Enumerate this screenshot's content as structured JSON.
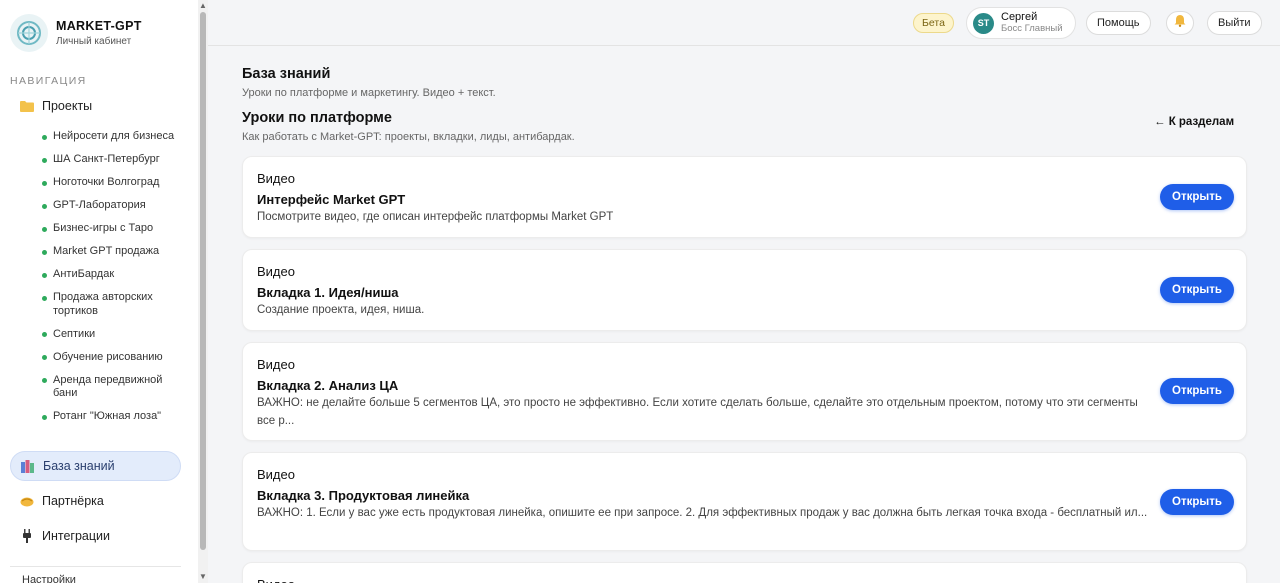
{
  "brand": {
    "name": "MARKET-GPT",
    "subtitle": "Личный кабинет"
  },
  "nav": {
    "heading": "НАВИГАЦИЯ",
    "projects_label": "Проекты",
    "projects": [
      "Нейросети для бизнеса",
      "ША Санкт-Петербург",
      "Ноготочки Волгоград",
      "GPT-Лаборатория",
      "Бизнес-игры с Таро",
      "Market GPT продажа",
      "АнтиБардак",
      "Продажа авторских тортиков",
      "Септики",
      "Обучение рисованию",
      "Аренда передвижной бани",
      "Ротанг \"Южная лоза\""
    ],
    "knowledge_base": "База знаний",
    "partner": "Партнёрка",
    "integrations": "Интеграции",
    "cut_off_item": "Настройки"
  },
  "topbar": {
    "beta": "Бета",
    "user_initials": "ST",
    "user_name": "Сергей",
    "user_role": "Босс Главный",
    "help": "Помощь",
    "logout": "Выйти"
  },
  "main": {
    "title": "База знаний",
    "subtitle": "Уроки по платформе и маркетингу. Видео + текст.",
    "section_title": "Уроки по платформе",
    "section_subtitle": "Как работать с Market-GPT: проекты, вкладки, лиды, антибардак.",
    "back_link": "← К разделам",
    "open_label": "Открыть",
    "lessons": [
      {
        "type": "Видео",
        "title": "Интерфейс Market GPT",
        "desc": "Посмотрите видео, где описан интерфейс платформы Market GPT"
      },
      {
        "type": "Видео",
        "title": "Вкладка 1. Идея/ниша",
        "desc": "Создание проекта, идея, ниша."
      },
      {
        "type": "Видео",
        "title": "Вкладка 2. Анализ ЦА",
        "desc": "ВАЖНО: не делайте больше 5 сегментов ЦА, это просто не эффективно. Если хотите сделать больше, сделайте это отдельным проектом, потому что эти сегменты все р..."
      },
      {
        "type": "Видео",
        "title": "Вкладка 3. Продуктовая линейка",
        "desc": "ВАЖНО: 1. Если у вас уже есть продуктовая линейка, опишите ее при запросе. 2. Для эффективных продаж у вас должна быть легкая точка входа - бесплатный ил..."
      },
      {
        "type": "Видео",
        "title": "",
        "desc": ""
      }
    ]
  },
  "colors": {
    "accent": "#1f5ee8",
    "status_dot": "#2eaa5c",
    "beta_bg": "#fdf4cc",
    "active_nav": "#e3ecfb"
  },
  "icons": {
    "logo": "logo-icon",
    "projects": "folder-icon",
    "knowledge": "books-icon",
    "partner": "handshake-icon",
    "integrations": "plug-icon",
    "bell": "bell-icon"
  }
}
